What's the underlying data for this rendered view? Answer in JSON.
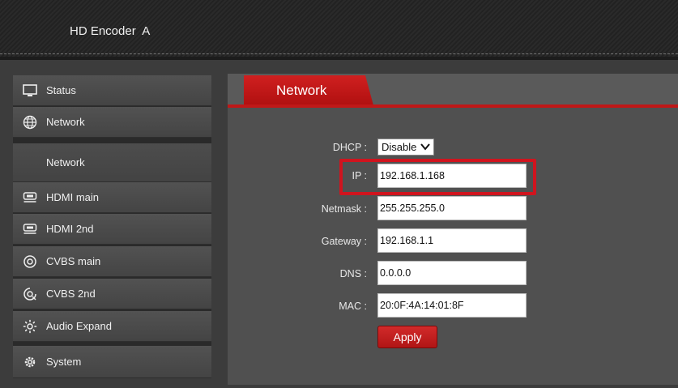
{
  "header": {
    "title": "HD Encoder  A"
  },
  "sidebar": {
    "items": [
      {
        "label": "Status",
        "icon": "monitor-icon"
      },
      {
        "label": "Network",
        "icon": "globe-icon"
      },
      {
        "label": "Network",
        "icon": ""
      },
      {
        "label": "HDMI main",
        "icon": "hdmi-icon"
      },
      {
        "label": "HDMI 2nd",
        "icon": "hdmi-icon"
      },
      {
        "label": "CVBS main",
        "icon": "cvbs-icon"
      },
      {
        "label": "CVBS 2nd",
        "icon": "cvbs-icon"
      },
      {
        "label": "Audio Expand",
        "icon": "audio-icon"
      },
      {
        "label": "System",
        "icon": "gear-icon"
      }
    ]
  },
  "content": {
    "tab": "Network",
    "form": {
      "dhcp_label": "DHCP :",
      "dhcp_value": "Disable",
      "ip_label": "IP :",
      "ip_value": "192.168.1.168",
      "netmask_label": "Netmask :",
      "netmask_value": "255.255.255.0",
      "gateway_label": "Gateway :",
      "gateway_value": "192.168.1.1",
      "dns_label": "DNS :",
      "dns_value": "0.0.0.0",
      "mac_label": "MAC :",
      "mac_value": "20:0F:4A:14:01:8F",
      "apply_label": "Apply"
    }
  },
  "colors": {
    "accent": "#c01818",
    "highlight": "#d0141e"
  }
}
